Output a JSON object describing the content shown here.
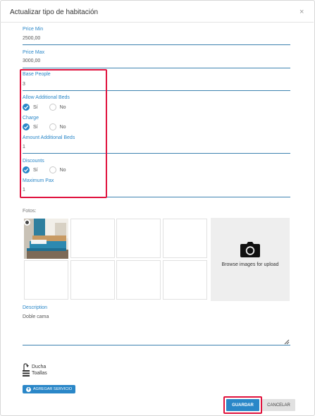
{
  "dialog": {
    "title": "Actualizar tipo de habitación",
    "close_glyph": "×"
  },
  "fields": {
    "price_min": {
      "label": "Price Min",
      "value": "2500,00"
    },
    "price_max": {
      "label": "Price Max",
      "value": "3000,00"
    },
    "base_people": {
      "label": "Base People",
      "value": "3"
    },
    "allow_additional_beds": {
      "label": "Allow Additional Beds",
      "yes": "Sí",
      "no": "No",
      "selected": "Sí"
    },
    "charge": {
      "label": "Charge",
      "yes": "Sí",
      "no": "No",
      "selected": "Sí"
    },
    "amount_additional_beds": {
      "label": "Amount Additional Beds",
      "value": "1"
    },
    "discounts": {
      "label": "Discounts",
      "yes": "Sí",
      "no": "No",
      "selected": "Sí"
    },
    "maximum_pax": {
      "label": "Maximum Pax",
      "value": "1"
    }
  },
  "fotos": {
    "label": "Fotos:",
    "upload_text": "Browse images for upload",
    "upload_icon": "camera-icon"
  },
  "description": {
    "label": "Description",
    "value": "Doble cama"
  },
  "services": [
    {
      "label": "Ducha",
      "icon": "shower-icon"
    },
    {
      "label": "Toallas",
      "icon": "towels-icon"
    }
  ],
  "buttons": {
    "add_service": "AGREGAR SERVICIO",
    "save": "GUARDAR",
    "cancel": "CANCELAR"
  },
  "colors": {
    "accent": "#2a87c8",
    "highlight": "#e0123d",
    "field_line": "#3d82b0"
  }
}
